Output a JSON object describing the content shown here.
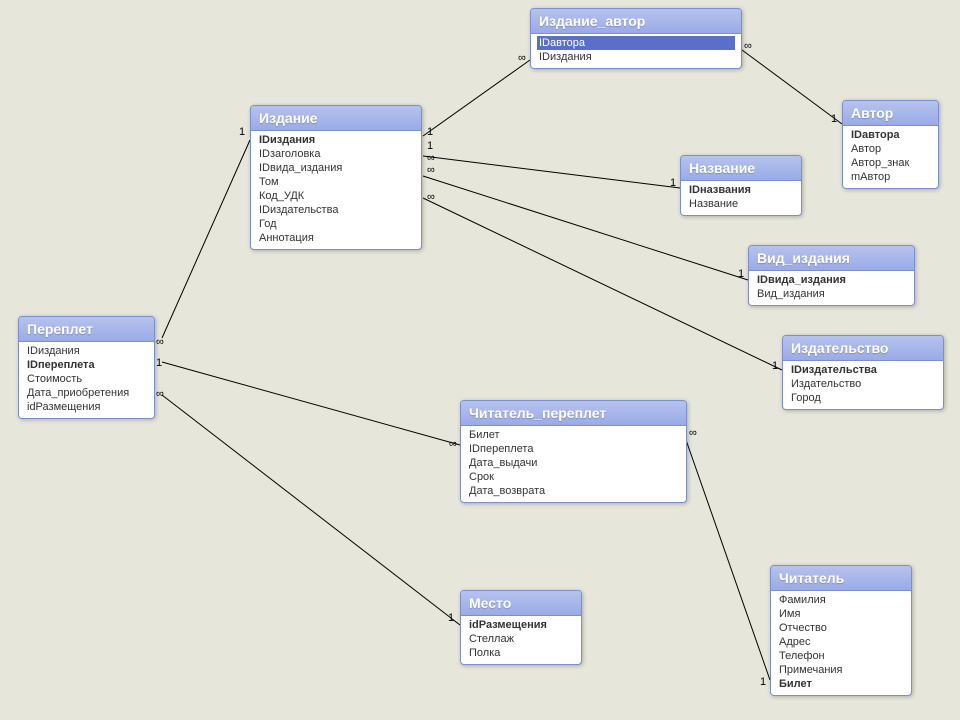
{
  "entities": {
    "pereplet": {
      "title": "Переплет",
      "fields": [
        {
          "name": "IDиздания",
          "pk": false
        },
        {
          "name": "IDпереплета",
          "pk": true
        },
        {
          "name": "Стоимость",
          "pk": false
        },
        {
          "name": "Дата_приобретения",
          "pk": false
        },
        {
          "name": "idРазмещения",
          "pk": false
        }
      ]
    },
    "izdanie": {
      "title": "Издание",
      "fields": [
        {
          "name": "IDиздания",
          "pk": true
        },
        {
          "name": "IDзаголовка",
          "pk": false
        },
        {
          "name": "IDвида_издания",
          "pk": false
        },
        {
          "name": "Том",
          "pk": false
        },
        {
          "name": "Код_УДК",
          "pk": false
        },
        {
          "name": "IDиздательства",
          "pk": false
        },
        {
          "name": "Год",
          "pk": false
        },
        {
          "name": "Аннотация",
          "pk": false
        }
      ]
    },
    "izdanie_avtor": {
      "title": "Издание_автор",
      "fields": [
        {
          "name": "IDавтора",
          "pk": false,
          "selected": true
        },
        {
          "name": "IDиздания",
          "pk": false
        }
      ]
    },
    "avtor": {
      "title": "Автор",
      "fields": [
        {
          "name": "IDавтора",
          "pk": true
        },
        {
          "name": "Автор",
          "pk": false
        },
        {
          "name": "Автор_знак",
          "pk": false
        },
        {
          "name": "mАвтор",
          "pk": false
        }
      ]
    },
    "nazvanie": {
      "title": "Название",
      "fields": [
        {
          "name": "IDназвания",
          "pk": true
        },
        {
          "name": "Название",
          "pk": false
        }
      ]
    },
    "vid_izdania": {
      "title": "Вид_издания",
      "fields": [
        {
          "name": "IDвида_издания",
          "pk": true
        },
        {
          "name": "Вид_издания",
          "pk": false
        }
      ]
    },
    "izdatelstvo": {
      "title": "Издательство",
      "fields": [
        {
          "name": "IDиздательства",
          "pk": true
        },
        {
          "name": "Издательство",
          "pk": false
        },
        {
          "name": "Город",
          "pk": false
        }
      ]
    },
    "chitatel_pereplet": {
      "title": "Читатель_переплет",
      "fields": [
        {
          "name": "Билет",
          "pk": false
        },
        {
          "name": "IDпереплета",
          "pk": false
        },
        {
          "name": "Дата_выдачи",
          "pk": false
        },
        {
          "name": "Срок",
          "pk": false
        },
        {
          "name": "Дата_возврата",
          "pk": false
        }
      ]
    },
    "chitatel": {
      "title": "Читатель",
      "fields": [
        {
          "name": "Фамилия",
          "pk": false
        },
        {
          "name": "Имя",
          "pk": false
        },
        {
          "name": "Отчество",
          "pk": false
        },
        {
          "name": "Адрес",
          "pk": false
        },
        {
          "name": "Телефон",
          "pk": false
        },
        {
          "name": "Примечания",
          "pk": false
        },
        {
          "name": "Билет",
          "pk": true
        }
      ]
    },
    "mesto": {
      "title": "Место",
      "fields": [
        {
          "name": "idРазмещения",
          "pk": true
        },
        {
          "name": "Стеллаж",
          "pk": false
        },
        {
          "name": "Полка",
          "pk": false
        }
      ]
    }
  },
  "cardinality": {
    "one": "1",
    "many": "∞"
  }
}
